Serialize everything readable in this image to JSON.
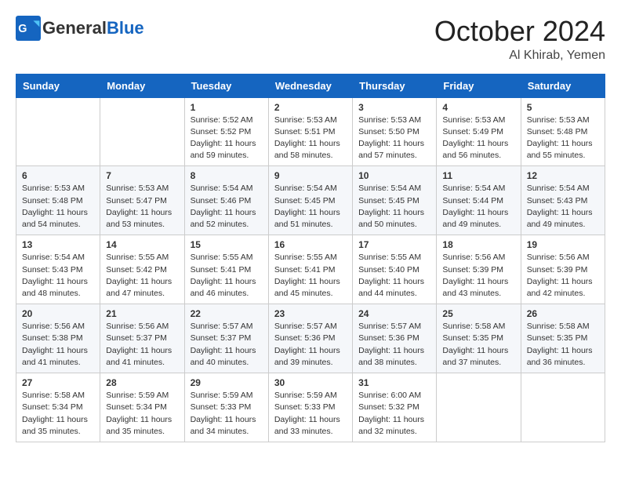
{
  "header": {
    "logo_general": "General",
    "logo_blue": "Blue",
    "month": "October 2024",
    "location": "Al Khirab, Yemen"
  },
  "days_of_week": [
    "Sunday",
    "Monday",
    "Tuesday",
    "Wednesday",
    "Thursday",
    "Friday",
    "Saturday"
  ],
  "weeks": [
    [
      {
        "day": "",
        "detail": ""
      },
      {
        "day": "",
        "detail": ""
      },
      {
        "day": "1",
        "detail": "Sunrise: 5:52 AM\nSunset: 5:52 PM\nDaylight: 11 hours and 59 minutes."
      },
      {
        "day": "2",
        "detail": "Sunrise: 5:53 AM\nSunset: 5:51 PM\nDaylight: 11 hours and 58 minutes."
      },
      {
        "day": "3",
        "detail": "Sunrise: 5:53 AM\nSunset: 5:50 PM\nDaylight: 11 hours and 57 minutes."
      },
      {
        "day": "4",
        "detail": "Sunrise: 5:53 AM\nSunset: 5:49 PM\nDaylight: 11 hours and 56 minutes."
      },
      {
        "day": "5",
        "detail": "Sunrise: 5:53 AM\nSunset: 5:48 PM\nDaylight: 11 hours and 55 minutes."
      }
    ],
    [
      {
        "day": "6",
        "detail": "Sunrise: 5:53 AM\nSunset: 5:48 PM\nDaylight: 11 hours and 54 minutes."
      },
      {
        "day": "7",
        "detail": "Sunrise: 5:53 AM\nSunset: 5:47 PM\nDaylight: 11 hours and 53 minutes."
      },
      {
        "day": "8",
        "detail": "Sunrise: 5:54 AM\nSunset: 5:46 PM\nDaylight: 11 hours and 52 minutes."
      },
      {
        "day": "9",
        "detail": "Sunrise: 5:54 AM\nSunset: 5:45 PM\nDaylight: 11 hours and 51 minutes."
      },
      {
        "day": "10",
        "detail": "Sunrise: 5:54 AM\nSunset: 5:45 PM\nDaylight: 11 hours and 50 minutes."
      },
      {
        "day": "11",
        "detail": "Sunrise: 5:54 AM\nSunset: 5:44 PM\nDaylight: 11 hours and 49 minutes."
      },
      {
        "day": "12",
        "detail": "Sunrise: 5:54 AM\nSunset: 5:43 PM\nDaylight: 11 hours and 49 minutes."
      }
    ],
    [
      {
        "day": "13",
        "detail": "Sunrise: 5:54 AM\nSunset: 5:43 PM\nDaylight: 11 hours and 48 minutes."
      },
      {
        "day": "14",
        "detail": "Sunrise: 5:55 AM\nSunset: 5:42 PM\nDaylight: 11 hours and 47 minutes."
      },
      {
        "day": "15",
        "detail": "Sunrise: 5:55 AM\nSunset: 5:41 PM\nDaylight: 11 hours and 46 minutes."
      },
      {
        "day": "16",
        "detail": "Sunrise: 5:55 AM\nSunset: 5:41 PM\nDaylight: 11 hours and 45 minutes."
      },
      {
        "day": "17",
        "detail": "Sunrise: 5:55 AM\nSunset: 5:40 PM\nDaylight: 11 hours and 44 minutes."
      },
      {
        "day": "18",
        "detail": "Sunrise: 5:56 AM\nSunset: 5:39 PM\nDaylight: 11 hours and 43 minutes."
      },
      {
        "day": "19",
        "detail": "Sunrise: 5:56 AM\nSunset: 5:39 PM\nDaylight: 11 hours and 42 minutes."
      }
    ],
    [
      {
        "day": "20",
        "detail": "Sunrise: 5:56 AM\nSunset: 5:38 PM\nDaylight: 11 hours and 41 minutes."
      },
      {
        "day": "21",
        "detail": "Sunrise: 5:56 AM\nSunset: 5:37 PM\nDaylight: 11 hours and 41 minutes."
      },
      {
        "day": "22",
        "detail": "Sunrise: 5:57 AM\nSunset: 5:37 PM\nDaylight: 11 hours and 40 minutes."
      },
      {
        "day": "23",
        "detail": "Sunrise: 5:57 AM\nSunset: 5:36 PM\nDaylight: 11 hours and 39 minutes."
      },
      {
        "day": "24",
        "detail": "Sunrise: 5:57 AM\nSunset: 5:36 PM\nDaylight: 11 hours and 38 minutes."
      },
      {
        "day": "25",
        "detail": "Sunrise: 5:58 AM\nSunset: 5:35 PM\nDaylight: 11 hours and 37 minutes."
      },
      {
        "day": "26",
        "detail": "Sunrise: 5:58 AM\nSunset: 5:35 PM\nDaylight: 11 hours and 36 minutes."
      }
    ],
    [
      {
        "day": "27",
        "detail": "Sunrise: 5:58 AM\nSunset: 5:34 PM\nDaylight: 11 hours and 35 minutes."
      },
      {
        "day": "28",
        "detail": "Sunrise: 5:59 AM\nSunset: 5:34 PM\nDaylight: 11 hours and 35 minutes."
      },
      {
        "day": "29",
        "detail": "Sunrise: 5:59 AM\nSunset: 5:33 PM\nDaylight: 11 hours and 34 minutes."
      },
      {
        "day": "30",
        "detail": "Sunrise: 5:59 AM\nSunset: 5:33 PM\nDaylight: 11 hours and 33 minutes."
      },
      {
        "day": "31",
        "detail": "Sunrise: 6:00 AM\nSunset: 5:32 PM\nDaylight: 11 hours and 32 minutes."
      },
      {
        "day": "",
        "detail": ""
      },
      {
        "day": "",
        "detail": ""
      }
    ]
  ]
}
